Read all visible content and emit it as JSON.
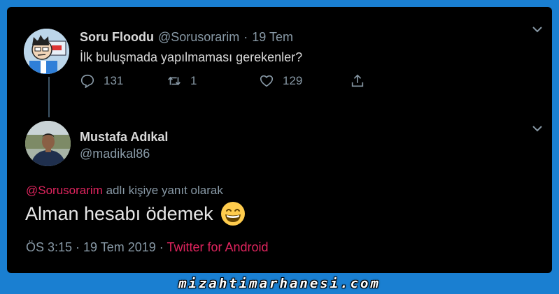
{
  "tweet1": {
    "name": "Soru Floodu",
    "handle": "@Sorusorarim",
    "dot": "·",
    "date": "19 Tem",
    "text": "İlk buluşmada yapılmaması gerekenler?",
    "reply_count": "131",
    "retweet_count": "1",
    "like_count": "129",
    "icons": [
      "reply-icon",
      "retweet-icon",
      "like-icon",
      "share-icon",
      "chevron-down-icon"
    ]
  },
  "tweet2": {
    "name": "Mustafa Adıkal",
    "handle": "@madikal86",
    "reply_mention": "@Sorusorarim",
    "reply_suffix": "adlı kişiye yanıt olarak",
    "text": "Alman hesabı ödemek",
    "emoji": "grinning-face-icon",
    "timestamp": "ÖS 3:15 · 19 Tem 2019",
    "meta_dot": " · ",
    "source": "Twitter for Android"
  },
  "footer": {
    "watermark": "mizahtimarhanesi.com"
  },
  "colors": {
    "background_frame": "#1a7fd1",
    "card": "#000000",
    "mention": "#e0245e",
    "muted": "#8899a6"
  }
}
